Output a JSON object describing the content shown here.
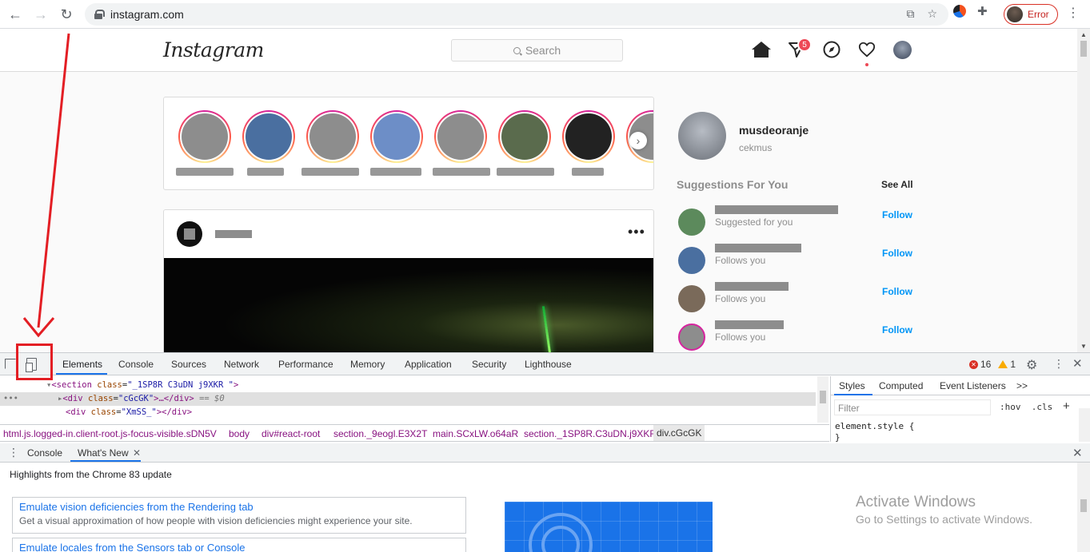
{
  "browser": {
    "url": "instagram.com",
    "profile_status": "Error",
    "colors": {
      "error": "#c5221f",
      "annotation": "#e31e24"
    }
  },
  "instagram": {
    "logo": "Instagram",
    "search_placeholder": "Search",
    "dm_badge": "5",
    "me": {
      "username": "musdeoranje",
      "fullname": "cekmus"
    },
    "suggestions_title": "Suggestions For You",
    "see_all": "See All",
    "suggestions": [
      {
        "sub": "Suggested for you",
        "action": "Follow"
      },
      {
        "sub": "Follows you",
        "action": "Follow"
      },
      {
        "sub": "Follows you",
        "action": "Follow"
      },
      {
        "sub": "Follows you",
        "action": "Follow"
      }
    ],
    "more_glyph": "•••",
    "colors": {
      "follow": "#0095f6",
      "badge": "#ed4956"
    }
  },
  "devtools": {
    "tabs": [
      "Elements",
      "Console",
      "Sources",
      "Network",
      "Performance",
      "Memory",
      "Application",
      "Security",
      "Lighthouse"
    ],
    "more_tabs": ">>",
    "errors": "16",
    "warnings": "1",
    "dom": [
      {
        "tag": "section",
        "attr": "class",
        "val": "_1SP8R C3uDN j9XKR  "
      },
      {
        "tag": "div",
        "attr": "class",
        "val": "cGcGK",
        "suffix": ">…</div>",
        "note": "== $0"
      },
      {
        "tag": "div",
        "attr": "class",
        "val": "XmSS_",
        "suffix": "></div>"
      }
    ],
    "breadcrumb": [
      "html.js.logged-in.client-root.js-focus-visible.sDN5V",
      "body",
      "div#react-root",
      "section._9eogl.E3X2T",
      "main.SCxLW.o64aR",
      "section._1SP8R.C3uDN.j9XKR",
      "div.cGcGK"
    ],
    "styles_tabs": [
      "Styles",
      "Computed",
      "Event Listeners"
    ],
    "styles_more": ">>",
    "filter_placeholder": "Filter",
    "hov": ":hov",
    "cls": ".cls",
    "plus": "+",
    "element_style": "element.style {",
    "element_style_close": "}",
    "drawer_tabs": [
      "Console",
      "What's New"
    ],
    "highlights_title": "Highlights from the Chrome 83 update",
    "cards": [
      {
        "title": "Emulate vision deficiencies from the Rendering tab",
        "desc": "Get a visual approximation of how people with vision deficiencies might experience your site."
      },
      {
        "title": "Emulate locales from the Sensors tab or Console",
        "desc": ""
      }
    ]
  },
  "windows": {
    "activate_title": "Activate Windows",
    "activate_sub": "Go to Settings to activate Windows."
  }
}
